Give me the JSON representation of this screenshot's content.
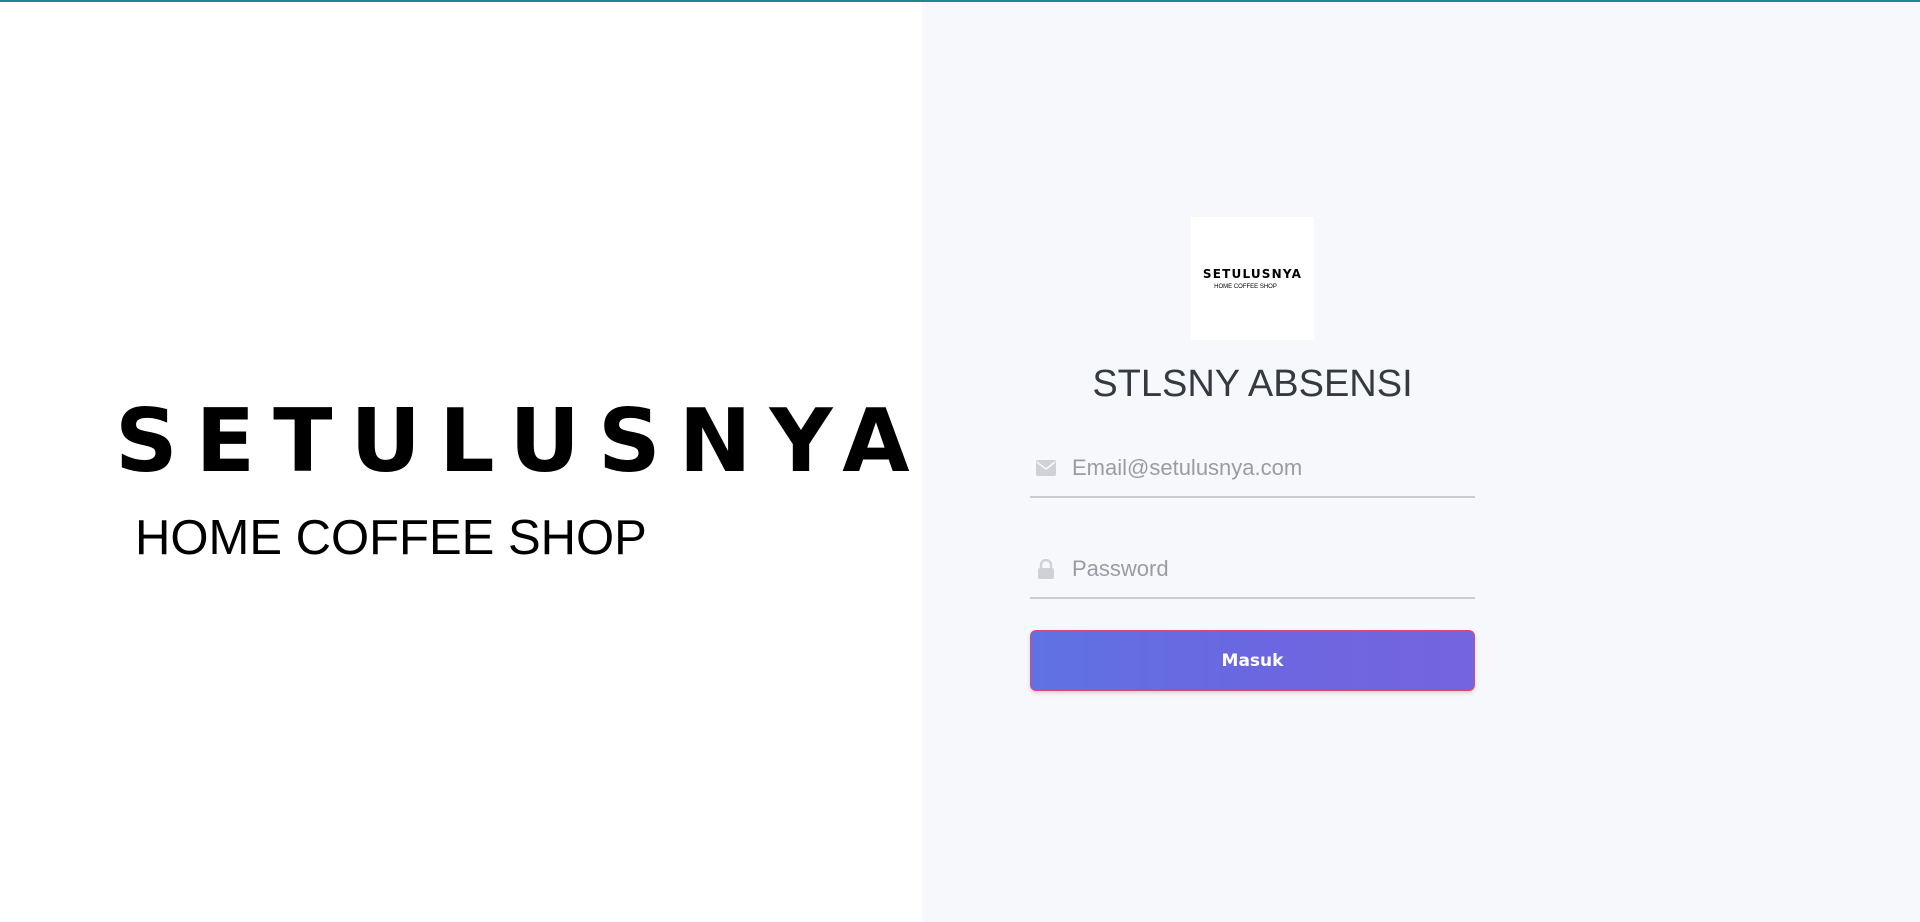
{
  "left_panel": {
    "brand_name": "SETULUSNYA",
    "brand_tagline": "HOME COFFEE SHOP"
  },
  "logo": {
    "brand_name": "SETULUSNYA",
    "brand_tagline": "HOME COFFEE SHOP"
  },
  "login_form": {
    "title": "STLSNY ABSENSI",
    "email": {
      "placeholder": "Email@setulusnya.com",
      "value": "",
      "icon": "envelope-icon"
    },
    "password": {
      "placeholder": "Password",
      "value": "",
      "icon": "lock-icon"
    },
    "submit_label": "Masuk"
  },
  "colors": {
    "top_line": "#1a8a8f",
    "right_background": "#f7f8fc",
    "button_gradient_start": "#5f72e4",
    "button_gradient_end": "#7564dd",
    "button_border": "#d9487a",
    "title_text": "#343a40",
    "placeholder_text": "#9a9ca3"
  }
}
